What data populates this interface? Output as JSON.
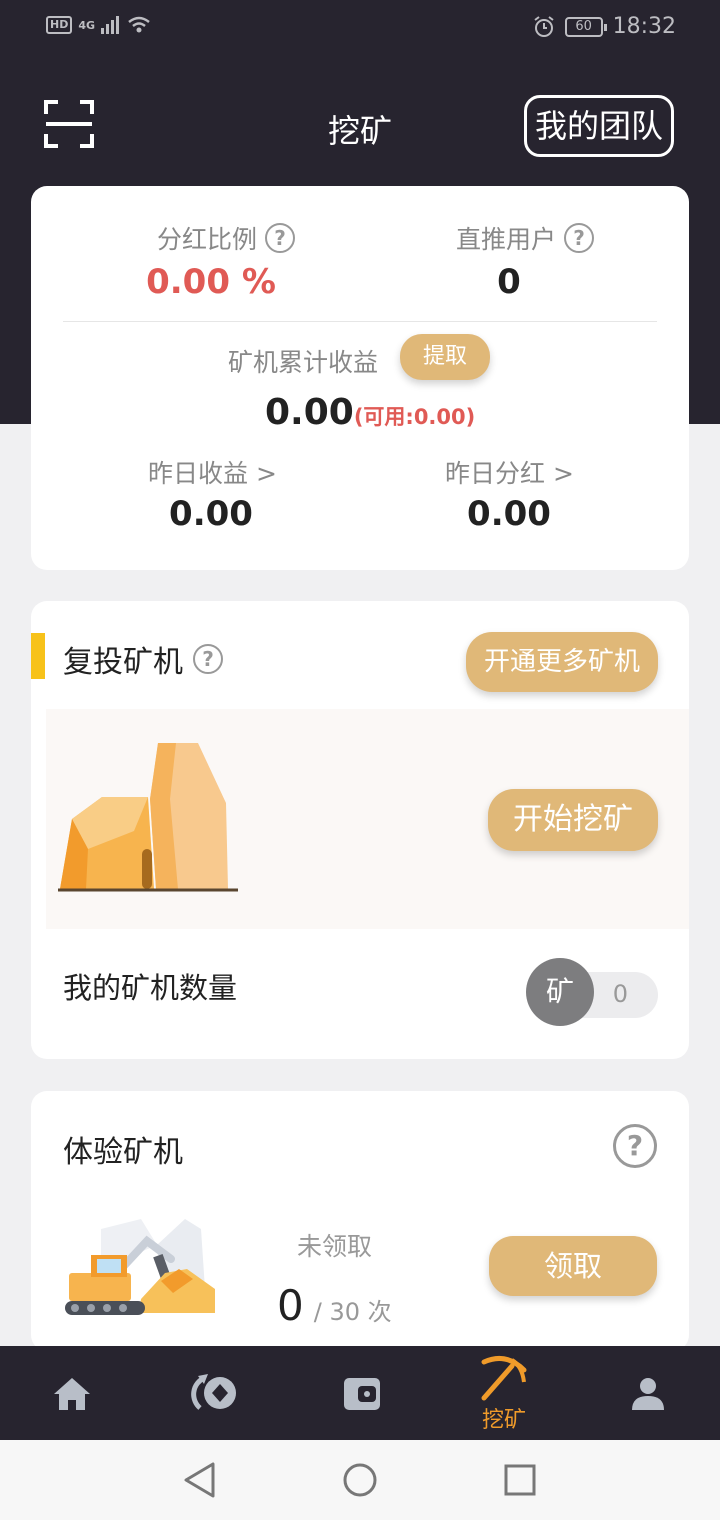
{
  "status_bar": {
    "hd": "HD",
    "network": "4G",
    "battery": "60",
    "time": "18:32"
  },
  "header": {
    "title": "挖矿",
    "team_button": "我的团队"
  },
  "summary": {
    "dividend_ratio_label": "分红比例",
    "dividend_ratio_value": "0.00 %",
    "direct_users_label": "直推用户",
    "direct_users_value": "0",
    "cumulative_label": "矿机累计收益",
    "withdraw_button": "提取",
    "cumulative_value": "0.00",
    "available_text": "(可用:0.00)",
    "yesterday_income_label": "昨日收益 >",
    "yesterday_income_value": "0.00",
    "yesterday_dividend_label": "昨日分红 >",
    "yesterday_dividend_value": "0.00"
  },
  "reinvest": {
    "title": "复投矿机",
    "open_more_button": "开通更多矿机",
    "start_mining_button": "开始挖矿",
    "my_count_label": "我的矿机数量",
    "count_badge": "矿",
    "count_value": "0"
  },
  "trial": {
    "title": "体验矿机",
    "status": "未领取",
    "used": "0",
    "total": "/ 30 次",
    "claim_button": "领取"
  },
  "tabbar": {
    "active_label": "挖矿"
  },
  "colors": {
    "dark_bg": "#27242f",
    "accent_gold": "#e0b878",
    "accent_orange": "#f09b2a",
    "red": "#e05a55",
    "yellow_bar": "#f7c21a"
  }
}
